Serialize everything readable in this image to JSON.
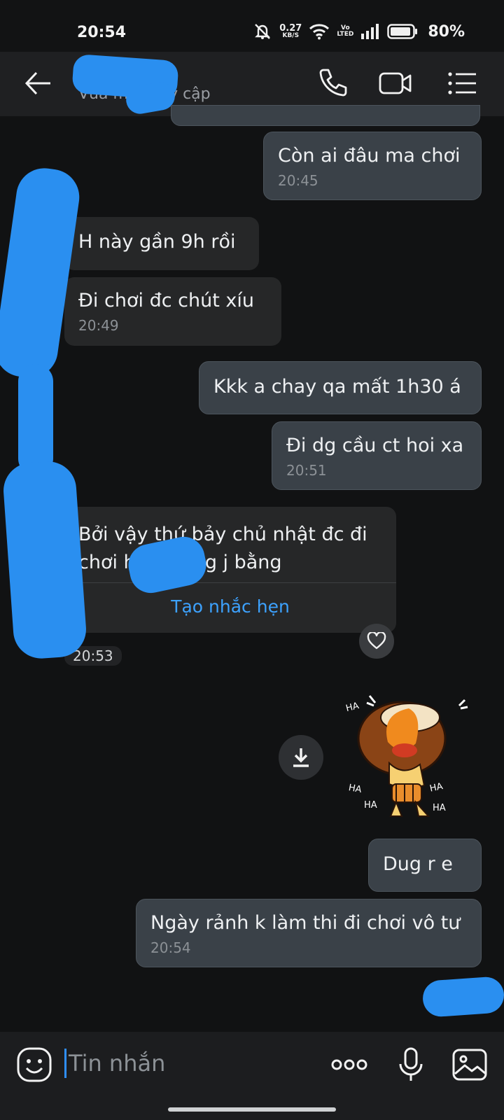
{
  "status_bar": {
    "time": "20:54",
    "net_speed_value": "0.27",
    "net_speed_unit": "KB/S",
    "volte_line1": "Vo",
    "volte_line2": "LTED",
    "battery": "80%"
  },
  "header": {
    "contact_name": "",
    "contact_status": "Vừa mới truy cập"
  },
  "messages": [
    {
      "dir": "out",
      "text": "Còn ai đâu ma chơi",
      "time": "20:45"
    },
    {
      "dir": "in",
      "text": "H này gần 9h rồi",
      "time": ""
    },
    {
      "dir": "in",
      "text": "Đi chơi đc chút xíu",
      "time": "20:49"
    },
    {
      "dir": "out",
      "text": "Kkk a chay qa mất 1h30 á",
      "time": ""
    },
    {
      "dir": "out",
      "text": "Đi dg cầu ct hoi xa",
      "time": "20:51"
    },
    {
      "dir": "out",
      "text": "Dug r e",
      "time": ""
    },
    {
      "dir": "out",
      "text": "Ngày rảnh k làm thi đi chơi vô tư",
      "time": "20:54"
    }
  ],
  "remind_card": {
    "text": "Bởi vậy thứ bảy chủ nhật đc đi chơi h... sương j bằng",
    "action": "Tạo nhắc hẹn",
    "time_chip": "20:53"
  },
  "sticker": {
    "caption": "HA HA HA HA HA"
  },
  "input": {
    "placeholder": "Tin nhắn"
  },
  "colors": {
    "accent": "#3da2ff",
    "outgoing_bubble": "#3a4148",
    "incoming_bubble": "#262728",
    "redaction": "#2a8ff0"
  },
  "icons": [
    "back-arrow-icon",
    "phone-icon",
    "video-call-icon",
    "menu-list-icon",
    "heart-icon",
    "download-icon",
    "emoji-icon",
    "more-dots-icon",
    "microphone-icon",
    "image-icon"
  ]
}
